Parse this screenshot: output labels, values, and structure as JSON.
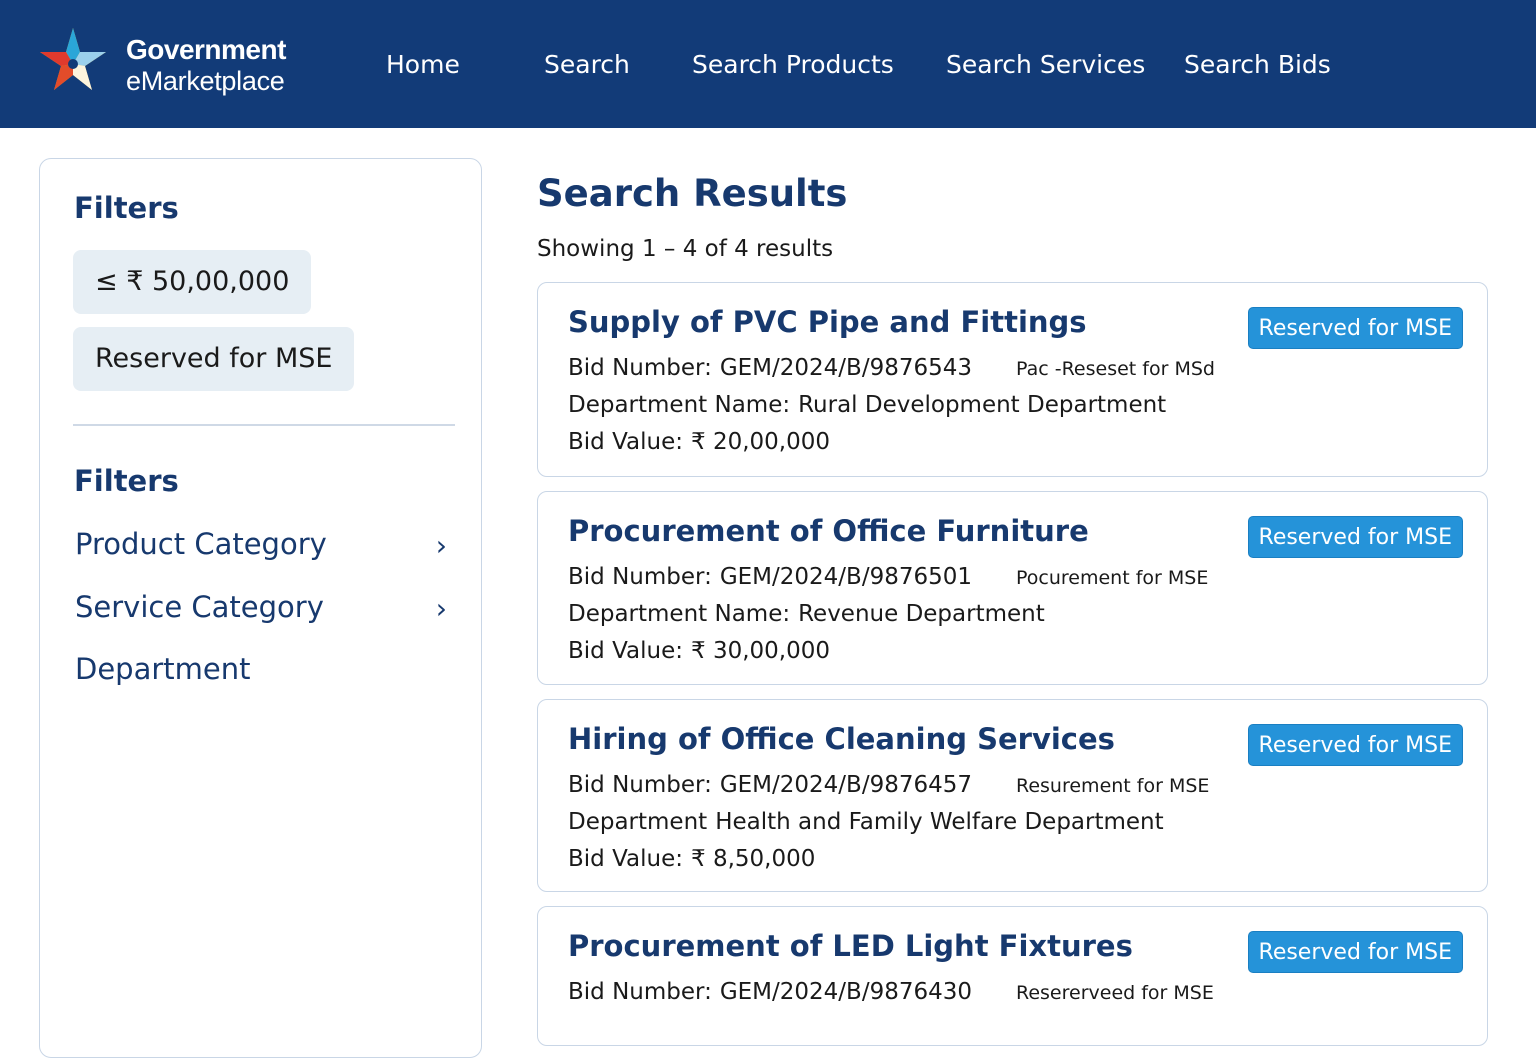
{
  "header": {
    "logo_line1": "Government",
    "logo_line2": "eMarketplace",
    "nav": [
      "Home",
      "Search",
      "Search Products",
      "Search Services",
      "Search Bids"
    ]
  },
  "sidebar": {
    "heading1": "Filters",
    "chips": [
      "≤  ₹ 50,00,000",
      "Reserved for MSE"
    ],
    "heading2": "Filters",
    "links": [
      "Product Category",
      "Service Category",
      "Department"
    ]
  },
  "main": {
    "title": "Search Results",
    "count": "Showing 1 – 4 of 4 results",
    "results": [
      {
        "title": "Supply of PVC Pipe and Fittings",
        "badge": "Reserved for MSE",
        "bid_label": "Bid Number:",
        "bid_number": "GEM/2024/B/9876543",
        "note": "Pac -Reseset for MSd",
        "dept_label": "Department Name:",
        "dept": "Rural Development Department",
        "value_label": "Bid Value:",
        "value": "₹ 20,00,000"
      },
      {
        "title": "Procurement of Office Furniture",
        "badge": "Reserved for MSE",
        "bid_label": "Bid Number:",
        "bid_number": "GEM/2024/B/9876501",
        "note": "Pocurement for MSE",
        "dept_label": "Department Name:",
        "dept": "Revenue Department",
        "value_label": "Bid Value:",
        "value": "₹ 30,00,000"
      },
      {
        "title": "Hiring of Office Cleaning Services",
        "badge": "Reserved for MSE",
        "bid_label": "Bid Number:",
        "bid_number": "GEM/2024/B/9876457",
        "note": "Resurement for MSE",
        "dept_label": "Department",
        "dept": "Health and Family Welfare Department",
        "value_label": "Bid Value:",
        "value": "₹ 8,50,000"
      },
      {
        "title": "Procurement of LED Light Fixtures",
        "badge": "Reserved for MSE",
        "bid_label": "Bid Number:",
        "bid_number": "GEM/2024/B/9876430",
        "note": "Resererveed for MSE"
      }
    ]
  },
  "colors": {
    "header_bg": "#123b78",
    "accent_text": "#17396e",
    "badge_bg": "#2593d9",
    "chip_bg": "#e6eef4"
  }
}
